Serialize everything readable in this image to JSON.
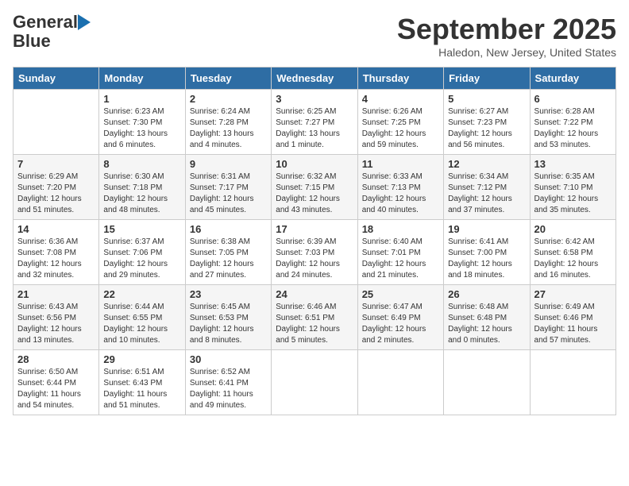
{
  "header": {
    "logo_line1": "General",
    "logo_line2": "Blue",
    "month": "September 2025",
    "location": "Haledon, New Jersey, United States"
  },
  "days_of_week": [
    "Sunday",
    "Monday",
    "Tuesday",
    "Wednesday",
    "Thursday",
    "Friday",
    "Saturday"
  ],
  "weeks": [
    [
      {
        "day": "",
        "info": ""
      },
      {
        "day": "1",
        "info": "Sunrise: 6:23 AM\nSunset: 7:30 PM\nDaylight: 13 hours\nand 6 minutes."
      },
      {
        "day": "2",
        "info": "Sunrise: 6:24 AM\nSunset: 7:28 PM\nDaylight: 13 hours\nand 4 minutes."
      },
      {
        "day": "3",
        "info": "Sunrise: 6:25 AM\nSunset: 7:27 PM\nDaylight: 13 hours\nand 1 minute."
      },
      {
        "day": "4",
        "info": "Sunrise: 6:26 AM\nSunset: 7:25 PM\nDaylight: 12 hours\nand 59 minutes."
      },
      {
        "day": "5",
        "info": "Sunrise: 6:27 AM\nSunset: 7:23 PM\nDaylight: 12 hours\nand 56 minutes."
      },
      {
        "day": "6",
        "info": "Sunrise: 6:28 AM\nSunset: 7:22 PM\nDaylight: 12 hours\nand 53 minutes."
      }
    ],
    [
      {
        "day": "7",
        "info": "Sunrise: 6:29 AM\nSunset: 7:20 PM\nDaylight: 12 hours\nand 51 minutes."
      },
      {
        "day": "8",
        "info": "Sunrise: 6:30 AM\nSunset: 7:18 PM\nDaylight: 12 hours\nand 48 minutes."
      },
      {
        "day": "9",
        "info": "Sunrise: 6:31 AM\nSunset: 7:17 PM\nDaylight: 12 hours\nand 45 minutes."
      },
      {
        "day": "10",
        "info": "Sunrise: 6:32 AM\nSunset: 7:15 PM\nDaylight: 12 hours\nand 43 minutes."
      },
      {
        "day": "11",
        "info": "Sunrise: 6:33 AM\nSunset: 7:13 PM\nDaylight: 12 hours\nand 40 minutes."
      },
      {
        "day": "12",
        "info": "Sunrise: 6:34 AM\nSunset: 7:12 PM\nDaylight: 12 hours\nand 37 minutes."
      },
      {
        "day": "13",
        "info": "Sunrise: 6:35 AM\nSunset: 7:10 PM\nDaylight: 12 hours\nand 35 minutes."
      }
    ],
    [
      {
        "day": "14",
        "info": "Sunrise: 6:36 AM\nSunset: 7:08 PM\nDaylight: 12 hours\nand 32 minutes."
      },
      {
        "day": "15",
        "info": "Sunrise: 6:37 AM\nSunset: 7:06 PM\nDaylight: 12 hours\nand 29 minutes."
      },
      {
        "day": "16",
        "info": "Sunrise: 6:38 AM\nSunset: 7:05 PM\nDaylight: 12 hours\nand 27 minutes."
      },
      {
        "day": "17",
        "info": "Sunrise: 6:39 AM\nSunset: 7:03 PM\nDaylight: 12 hours\nand 24 minutes."
      },
      {
        "day": "18",
        "info": "Sunrise: 6:40 AM\nSunset: 7:01 PM\nDaylight: 12 hours\nand 21 minutes."
      },
      {
        "day": "19",
        "info": "Sunrise: 6:41 AM\nSunset: 7:00 PM\nDaylight: 12 hours\nand 18 minutes."
      },
      {
        "day": "20",
        "info": "Sunrise: 6:42 AM\nSunset: 6:58 PM\nDaylight: 12 hours\nand 16 minutes."
      }
    ],
    [
      {
        "day": "21",
        "info": "Sunrise: 6:43 AM\nSunset: 6:56 PM\nDaylight: 12 hours\nand 13 minutes."
      },
      {
        "day": "22",
        "info": "Sunrise: 6:44 AM\nSunset: 6:55 PM\nDaylight: 12 hours\nand 10 minutes."
      },
      {
        "day": "23",
        "info": "Sunrise: 6:45 AM\nSunset: 6:53 PM\nDaylight: 12 hours\nand 8 minutes."
      },
      {
        "day": "24",
        "info": "Sunrise: 6:46 AM\nSunset: 6:51 PM\nDaylight: 12 hours\nand 5 minutes."
      },
      {
        "day": "25",
        "info": "Sunrise: 6:47 AM\nSunset: 6:49 PM\nDaylight: 12 hours\nand 2 minutes."
      },
      {
        "day": "26",
        "info": "Sunrise: 6:48 AM\nSunset: 6:48 PM\nDaylight: 12 hours\nand 0 minutes."
      },
      {
        "day": "27",
        "info": "Sunrise: 6:49 AM\nSunset: 6:46 PM\nDaylight: 11 hours\nand 57 minutes."
      }
    ],
    [
      {
        "day": "28",
        "info": "Sunrise: 6:50 AM\nSunset: 6:44 PM\nDaylight: 11 hours\nand 54 minutes."
      },
      {
        "day": "29",
        "info": "Sunrise: 6:51 AM\nSunset: 6:43 PM\nDaylight: 11 hours\nand 51 minutes."
      },
      {
        "day": "30",
        "info": "Sunrise: 6:52 AM\nSunset: 6:41 PM\nDaylight: 11 hours\nand 49 minutes."
      },
      {
        "day": "",
        "info": ""
      },
      {
        "day": "",
        "info": ""
      },
      {
        "day": "",
        "info": ""
      },
      {
        "day": "",
        "info": ""
      }
    ]
  ]
}
